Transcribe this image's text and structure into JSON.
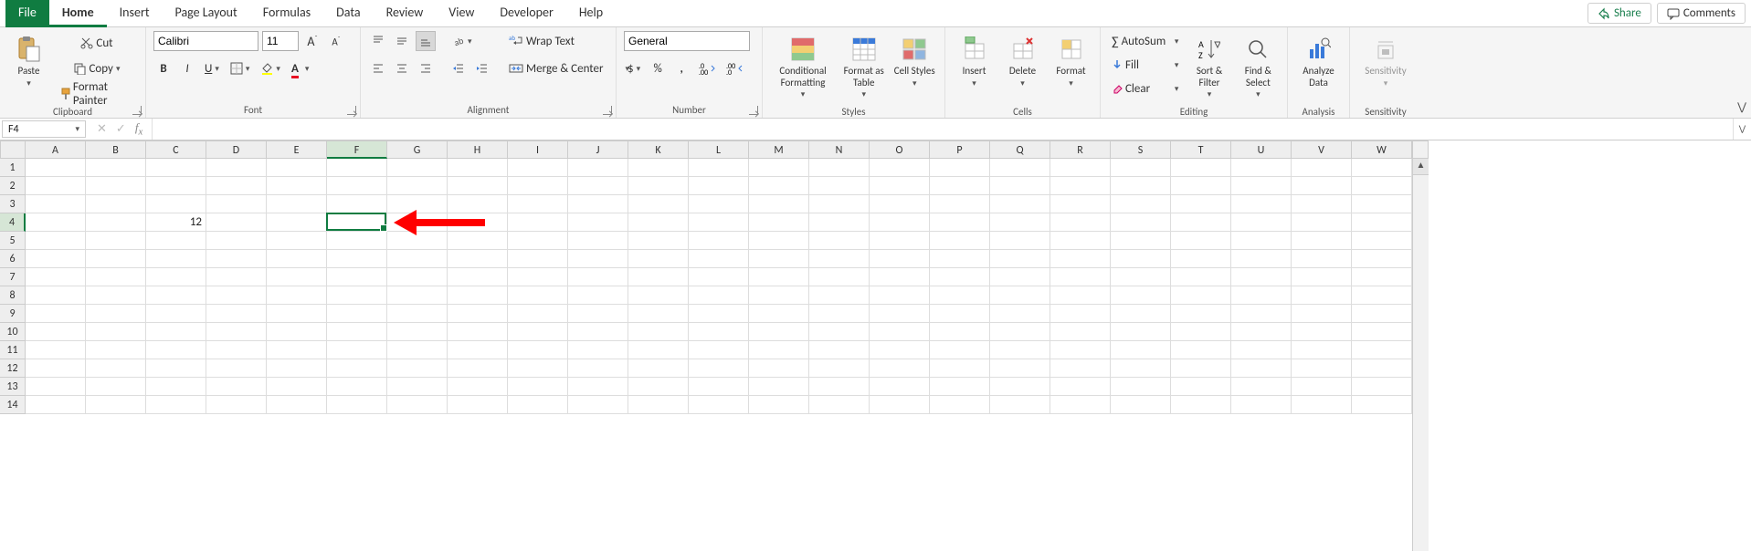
{
  "tabs": [
    "File",
    "Home",
    "Insert",
    "Page Layout",
    "Formulas",
    "Data",
    "Review",
    "View",
    "Developer",
    "Help"
  ],
  "active_tab": "Home",
  "share": "Share",
  "comments": "Comments",
  "clipboard": {
    "paste": "Paste",
    "cut": "Cut",
    "copy": "Copy",
    "format_painter": "Format Painter",
    "label": "Clipboard"
  },
  "font": {
    "name": "Calibri",
    "size": "11",
    "label": "Font"
  },
  "alignment": {
    "wrap": "Wrap Text",
    "merge": "Merge & Center",
    "label": "Alignment"
  },
  "number": {
    "format": "General",
    "label": "Number"
  },
  "styles": {
    "cond": "Conditional Formatting",
    "table": "Format as Table",
    "cell": "Cell Styles",
    "label": "Styles"
  },
  "cells": {
    "insert": "Insert",
    "delete": "Delete",
    "format": "Format",
    "label": "Cells"
  },
  "editing": {
    "sum": "AutoSum",
    "fill": "Fill",
    "clear": "Clear",
    "sort": "Sort & Filter",
    "find": "Find & Select",
    "label": "Editing"
  },
  "analysis": {
    "analyze": "Analyze Data",
    "label": "Analysis"
  },
  "sensitivity": {
    "btn": "Sensitivity",
    "label": "Sensitivity"
  },
  "namebox": "F4",
  "formula": "",
  "columns": [
    "A",
    "B",
    "C",
    "D",
    "E",
    "F",
    "G",
    "H",
    "I",
    "J",
    "K",
    "L",
    "M",
    "N",
    "O",
    "P",
    "Q",
    "R",
    "S",
    "T",
    "U",
    "V",
    "W"
  ],
  "rows": [
    1,
    2,
    3,
    4,
    5,
    6,
    7,
    8,
    9,
    10,
    11,
    12,
    13,
    14
  ],
  "cell_C4": "12",
  "selected_col": "F",
  "selected_row": 4
}
